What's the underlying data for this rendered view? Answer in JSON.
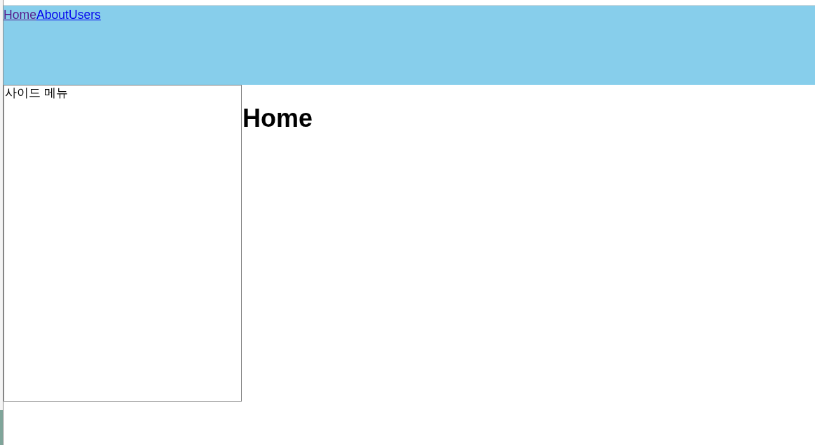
{
  "nav": {
    "links": [
      {
        "label": "Home",
        "visited": true
      },
      {
        "label": "About",
        "visited": false
      },
      {
        "label": "Users",
        "visited": false
      }
    ]
  },
  "sidebar": {
    "title": "사이드 메뉴"
  },
  "main": {
    "heading": "Home"
  }
}
